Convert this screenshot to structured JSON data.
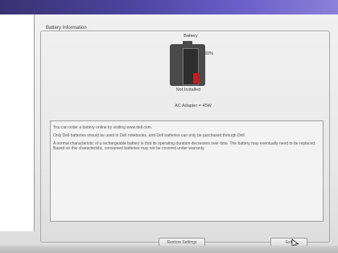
{
  "group": {
    "title": "Battery Information"
  },
  "battery": {
    "label": "Battery",
    "percent_text": "60%",
    "level_fraction": 0.3,
    "level_color": "#c02020",
    "status": "Not Installed"
  },
  "adapter": {
    "text": "AC Adapter = 45W"
  },
  "info": {
    "line1": "You can order a battery online by visiting www.dell.com.",
    "line2": "Only Dell batteries should be used in Dell notebooks, and Dell batteries can only be purchased through Dell.",
    "line3": "A normal characteristic of a rechargeable battery is that its operating duration decreases over time. The battery may eventually need to be replaced. Based on this characteristic, consumed batteries may not be covered under warranty."
  },
  "buttons": {
    "restore_label": "Restore Settings",
    "exit_label": "Exit"
  }
}
